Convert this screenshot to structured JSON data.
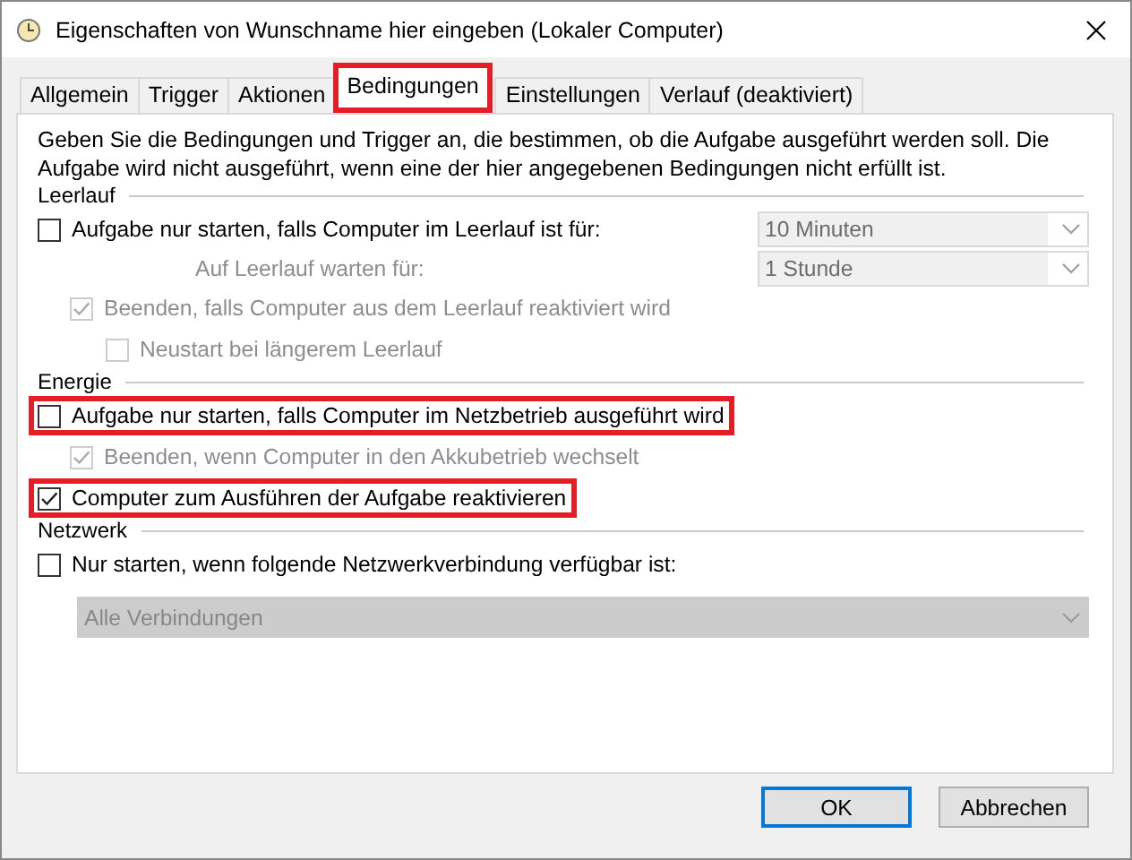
{
  "window": {
    "title": "Eigenschaften von Wunschname hier eingeben (Lokaler Computer)"
  },
  "tabs": [
    {
      "label": "Allgemein",
      "selected": false,
      "highlighted": false
    },
    {
      "label": "Trigger",
      "selected": false,
      "highlighted": false
    },
    {
      "label": "Aktionen",
      "selected": false,
      "highlighted": false
    },
    {
      "label": "Bedingungen",
      "selected": true,
      "highlighted": true
    },
    {
      "label": "Einstellungen",
      "selected": false,
      "highlighted": false
    },
    {
      "label": "Verlauf (deaktiviert)",
      "selected": false,
      "highlighted": false
    }
  ],
  "description": "Geben Sie die Bedingungen und Trigger an, die bestimmen, ob die Aufgabe ausgeführt werden soll. Die Aufgabe wird nicht ausgeführt, wenn eine der hier angegebenen Bedingungen nicht erfüllt ist.",
  "sections": [
    {
      "title": "Leerlauf",
      "rows": [
        {
          "kind": "checkbox",
          "label": "Aufgabe nur starten, falls Computer im Leerlauf ist für:",
          "checked": false,
          "disabled": false,
          "highlighted": false,
          "dropdown": {
            "value": "10 Minuten",
            "disabled": true
          },
          "children": [
            {
              "kind": "label",
              "label": "Auf Leerlauf warten für:",
              "disabled": true,
              "dropdown": {
                "value": "1 Stunde",
                "disabled": true
              }
            },
            {
              "kind": "checkbox",
              "label": "Beenden, falls Computer aus dem Leerlauf reaktiviert wird",
              "checked": true,
              "disabled": true,
              "highlighted": false,
              "children": [
                {
                  "kind": "checkbox",
                  "label": "Neustart bei längerem Leerlauf",
                  "checked": false,
                  "disabled": true,
                  "highlighted": false
                }
              ]
            }
          ]
        }
      ]
    },
    {
      "title": "Energie",
      "rows": [
        {
          "kind": "checkbox",
          "label": "Aufgabe nur starten, falls Computer im Netzbetrieb ausgeführt wird",
          "checked": false,
          "disabled": false,
          "highlighted": true,
          "children": [
            {
              "kind": "checkbox",
              "label": "Beenden, wenn Computer in den Akkubetrieb wechselt",
              "checked": true,
              "disabled": true,
              "highlighted": false
            }
          ]
        },
        {
          "kind": "checkbox",
          "label": "Computer zum Ausführen der Aufgabe reaktivieren",
          "checked": true,
          "disabled": false,
          "highlighted": true
        }
      ]
    },
    {
      "title": "Netzwerk",
      "rows": [
        {
          "kind": "checkbox",
          "label": "Nur starten, wenn folgende Netzwerkverbindung verfügbar ist:",
          "checked": false,
          "disabled": false,
          "highlighted": false
        },
        {
          "kind": "select",
          "dropdown": {
            "value": "Alle Verbindungen",
            "disabled": true
          }
        }
      ]
    }
  ],
  "buttons": [
    {
      "label": "OK",
      "default": true
    },
    {
      "label": "Abbrechen",
      "default": false
    }
  ]
}
